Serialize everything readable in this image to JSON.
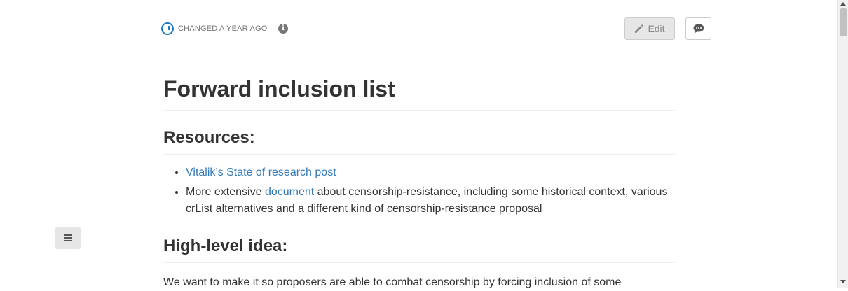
{
  "header": {
    "status_text": "CHANGED A YEAR AGO",
    "info_glyph": "i",
    "edit_label": "Edit"
  },
  "icons": {
    "status": "power-icon",
    "info": "info-icon",
    "edit": "pencil-icon",
    "comment": "comment-icon",
    "toc": "menu-icon"
  },
  "colors": {
    "link": "#337ab7",
    "status_accent": "#1e7ac4",
    "text": "#333333"
  },
  "document": {
    "title": "Forward inclusion list",
    "resources_heading": "Resources:",
    "resources": {
      "item1_link": "Vitalik’s State of research post",
      "item2_prefix": "More extensive ",
      "item2_link": "document",
      "item2_suffix": " about censorship-resistance, including some historical context, various crList alternatives and a different kind of censorship-resistance proposal"
    },
    "high_level_heading": "High-level idea:",
    "high_level_paragraph": "We want to make it so proposers are able to combat censorship by forcing inclusion of some"
  }
}
